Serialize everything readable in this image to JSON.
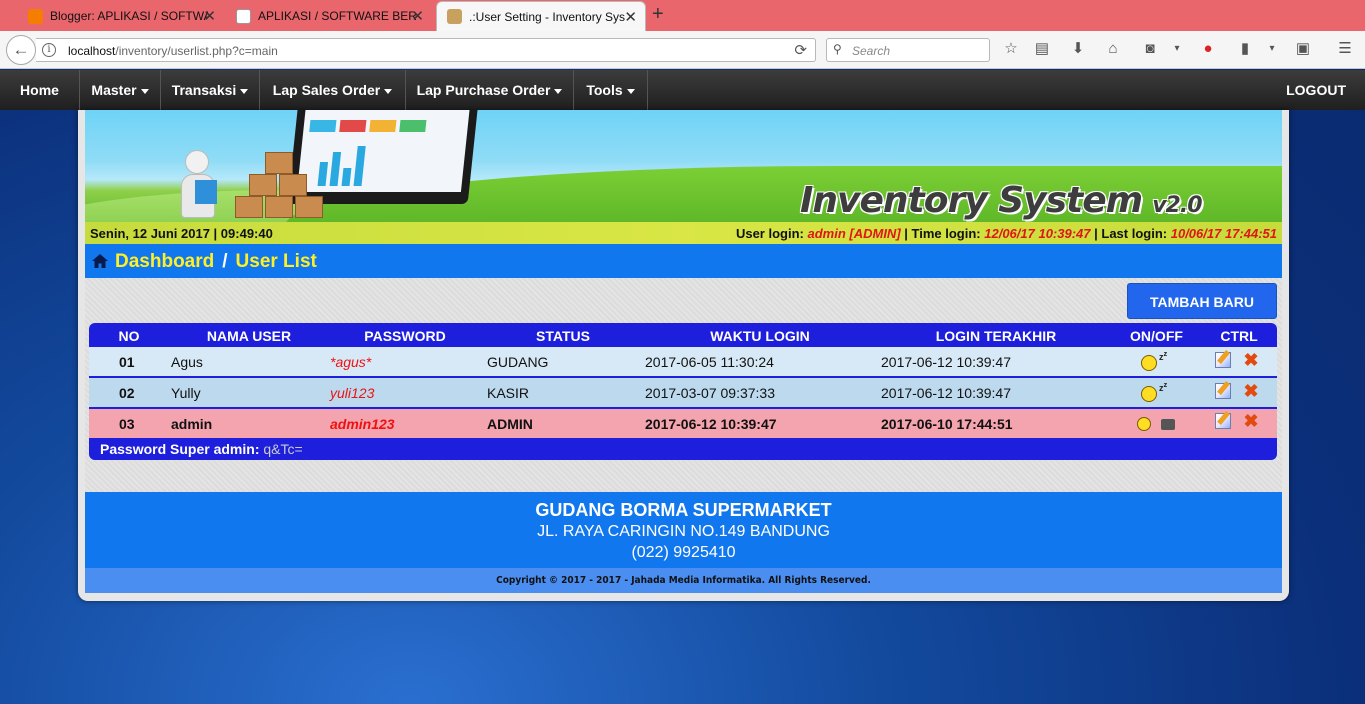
{
  "browser": {
    "tabs": [
      {
        "title": "Blogger: APLIKASI / SOFTWA"
      },
      {
        "title": "APLIKASI / SOFTWARE BERB"
      },
      {
        "title": ".:User Setting - Inventory Sys"
      }
    ],
    "url_host": "localhost",
    "url_path": "/inventory/userlist.php?c=main",
    "search_placeholder": "Search"
  },
  "menu": {
    "items": [
      {
        "label": "Home"
      },
      {
        "label": "Master"
      },
      {
        "label": "Transaksi"
      },
      {
        "label": "Lap Sales Order"
      },
      {
        "label": "Lap Purchase Order"
      },
      {
        "label": "Tools"
      }
    ],
    "logout": "LOGOUT"
  },
  "banner": {
    "brand": "Inventory System",
    "version": "v2.0"
  },
  "infobar": {
    "date": "Senin, 12 Juni 2017 | 09:49:40",
    "user_login_label": "User login:",
    "user_login_value": "admin [ADMIN]",
    "time_login_label": "| Time login:",
    "time_login_value": "12/06/17 10:39:47",
    "last_login_label": "| Last login:",
    "last_login_value": "10/06/17 17:44:51"
  },
  "breadcrumb": {
    "home": "Dashboard",
    "current": "User List",
    "separator": "/"
  },
  "add_button": "TAMBAH BARU",
  "table": {
    "headers": [
      "NO",
      "NAMA USER",
      "PASSWORD",
      "STATUS",
      "WAKTU LOGIN",
      "LOGIN TERAKHIR",
      "ON/OFF",
      "CTRL"
    ],
    "rows": [
      {
        "no": "01",
        "name": "Agus",
        "password": "*agus*",
        "status": "GUDANG",
        "login": "2017-06-05 11:30:24",
        "last": "2017-06-12 10:39:47",
        "state": "offline"
      },
      {
        "no": "02",
        "name": "Yully",
        "password": "yuli123",
        "status": "KASIR",
        "login": "2017-03-07 09:37:33",
        "last": "2017-06-12 10:39:47",
        "state": "offline"
      },
      {
        "no": "03",
        "name": "admin",
        "password": "admin123",
        "status": "ADMIN",
        "login": "2017-06-12 10:39:47",
        "last": "2017-06-10 17:44:51",
        "state": "online"
      }
    ],
    "footer_label": "Password Super admin:",
    "footer_value": "q&Tc="
  },
  "footer": {
    "name": "GUDANG BORMA SUPERMARKET",
    "address": "JL. RAYA CARINGIN NO.149 BANDUNG",
    "phone": "(022) 9925410",
    "copyright": "Copyright © 2017 - 2017 - Jahada Media Informatika. All Rights Reserved."
  },
  "colors": {
    "accent": "#1177EE",
    "menu": "#2A2A2A",
    "table_header": "#1E1EDD",
    "highlight_row": "#F4A4AE",
    "alert_text": "#E01515"
  }
}
